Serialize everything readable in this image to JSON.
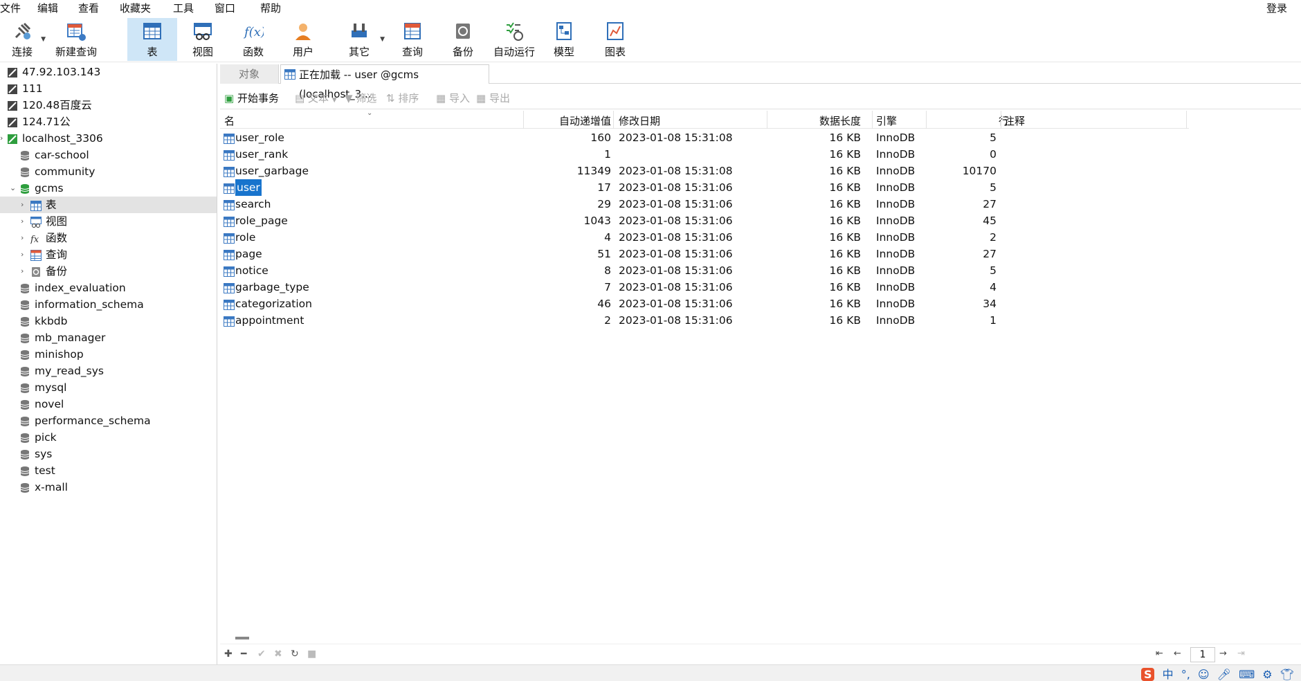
{
  "menu": [
    "文件",
    "编辑",
    "查看",
    "收藏夹",
    "工具",
    "窗口",
    "帮助"
  ],
  "login_label": "登录",
  "toolbar": [
    {
      "label": "连接",
      "icon": "plug-icon"
    },
    {
      "label": "新建查询",
      "icon": "new-query-icon"
    },
    {
      "label": "表",
      "icon": "table-icon"
    },
    {
      "label": "视图",
      "icon": "view-icon"
    },
    {
      "label": "函数",
      "icon": "function-icon"
    },
    {
      "label": "用户",
      "icon": "user-icon"
    },
    {
      "label": "其它",
      "icon": "tools-icon"
    },
    {
      "label": "查询",
      "icon": "query-icon"
    },
    {
      "label": "备份",
      "icon": "backup-icon"
    },
    {
      "label": "自动运行",
      "icon": "schedule-icon"
    },
    {
      "label": "模型",
      "icon": "model-icon"
    },
    {
      "label": "图表",
      "icon": "chart-icon"
    }
  ],
  "tree": [
    {
      "label": "47.92.103.143"
    },
    {
      "label": "111"
    },
    {
      "label": "120.48百度云"
    },
    {
      "label": "124.71公"
    },
    {
      "label": "localhost_3306"
    },
    {
      "label": "car-school"
    },
    {
      "label": "community"
    },
    {
      "label": "gcms"
    },
    {
      "label": "表"
    },
    {
      "label": "视图"
    },
    {
      "label": "函数"
    },
    {
      "label": "查询"
    },
    {
      "label": "备份"
    },
    {
      "label": "index_evaluation"
    },
    {
      "label": "information_schema"
    },
    {
      "label": "kkbdb"
    },
    {
      "label": "mb_manager"
    },
    {
      "label": "minishop"
    },
    {
      "label": "my_read_sys"
    },
    {
      "label": "mysql"
    },
    {
      "label": "novel"
    },
    {
      "label": "performance_schema"
    },
    {
      "label": "pick"
    },
    {
      "label": "sys"
    },
    {
      "label": "test"
    },
    {
      "label": "x-mall"
    }
  ],
  "tabs": {
    "objects": "对象",
    "active": "正在加载 -- user @gcms (localhost_3..."
  },
  "objbar": {
    "begin_tx": "开始事务",
    "text": "文本",
    "filter": "筛选",
    "sort": "排序",
    "import": "导入",
    "export": "导出"
  },
  "columns": {
    "name": "名",
    "auto_inc": "自动递增值",
    "modified": "修改日期",
    "data_len": "数据长度",
    "engine": "引擎",
    "rows": "行",
    "comment": "注释"
  },
  "rows": [
    {
      "name": "user_role",
      "auto_inc": "160",
      "modified": "2023-01-08 15:31:08",
      "data_len": "16 KB",
      "engine": "InnoDB",
      "rows": "5"
    },
    {
      "name": "user_rank",
      "auto_inc": "1",
      "modified": "",
      "data_len": "16 KB",
      "engine": "InnoDB",
      "rows": "0"
    },
    {
      "name": "user_garbage",
      "auto_inc": "11349",
      "modified": "2023-01-08 15:31:08",
      "data_len": "16 KB",
      "engine": "InnoDB",
      "rows": "10170"
    },
    {
      "name": "user",
      "auto_inc": "17",
      "modified": "2023-01-08 15:31:06",
      "data_len": "16 KB",
      "engine": "InnoDB",
      "rows": "5"
    },
    {
      "name": "search",
      "auto_inc": "29",
      "modified": "2023-01-08 15:31:06",
      "data_len": "16 KB",
      "engine": "InnoDB",
      "rows": "27"
    },
    {
      "name": "role_page",
      "auto_inc": "1043",
      "modified": "2023-01-08 15:31:06",
      "data_len": "16 KB",
      "engine": "InnoDB",
      "rows": "45"
    },
    {
      "name": "role",
      "auto_inc": "4",
      "modified": "2023-01-08 15:31:06",
      "data_len": "16 KB",
      "engine": "InnoDB",
      "rows": "2"
    },
    {
      "name": "page",
      "auto_inc": "51",
      "modified": "2023-01-08 15:31:06",
      "data_len": "16 KB",
      "engine": "InnoDB",
      "rows": "27"
    },
    {
      "name": "notice",
      "auto_inc": "8",
      "modified": "2023-01-08 15:31:06",
      "data_len": "16 KB",
      "engine": "InnoDB",
      "rows": "5"
    },
    {
      "name": "garbage_type",
      "auto_inc": "7",
      "modified": "2023-01-08 15:31:06",
      "data_len": "16 KB",
      "engine": "InnoDB",
      "rows": "4"
    },
    {
      "name": "categorization",
      "auto_inc": "46",
      "modified": "2023-01-08 15:31:06",
      "data_len": "16 KB",
      "engine": "InnoDB",
      "rows": "34"
    },
    {
      "name": "appointment",
      "auto_inc": "2",
      "modified": "2023-01-08 15:31:06",
      "data_len": "16 KB",
      "engine": "InnoDB",
      "rows": "1"
    }
  ],
  "pager": {
    "page": "1"
  },
  "ime": {
    "brand": "S",
    "lang": "中",
    "punct": "°,"
  },
  "colors": {
    "accent": "#1874cd",
    "active_tool": "#cfe6f7",
    "db_green": "#2e9e3e"
  }
}
